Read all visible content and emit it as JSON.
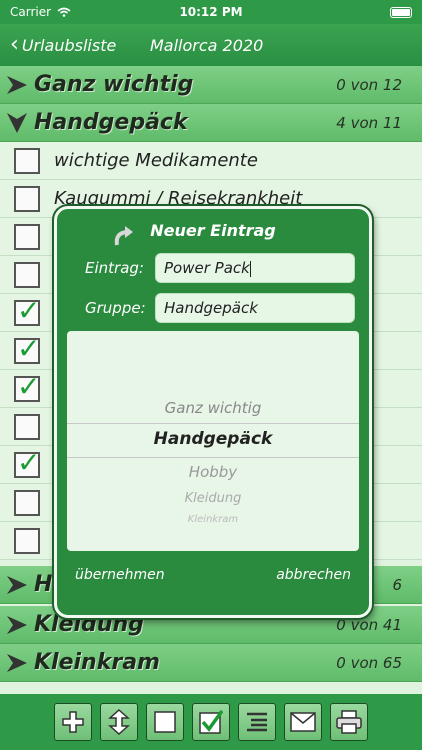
{
  "status": {
    "carrier": "Carrier",
    "time": "10:12 PM"
  },
  "nav": {
    "back_label": "Urlaubsliste",
    "title": "Mallorca 2020"
  },
  "groups": {
    "g1": {
      "name": "Ganz wichtig",
      "count": "0 von 12"
    },
    "g2": {
      "name": "Handgepäck",
      "count": "4 von 11"
    },
    "g3": {
      "name": "H",
      "count": "6"
    },
    "g4": {
      "name": "Kleidung",
      "count": "0 von 41"
    },
    "g5": {
      "name": "Kleinkram",
      "count": "0 von 65"
    }
  },
  "items": [
    {
      "name": "wichtige Medikamente",
      "checked": false
    },
    {
      "name": "Kaugummi / Reisekrankheit",
      "checked": false
    },
    {
      "name": "",
      "checked": false
    },
    {
      "name": "",
      "checked": false
    },
    {
      "name": "",
      "checked": true
    },
    {
      "name": "",
      "checked": true
    },
    {
      "name": "",
      "checked": true
    },
    {
      "name": "",
      "checked": false
    },
    {
      "name": "",
      "checked": true
    },
    {
      "name": "",
      "checked": false
    },
    {
      "name": "",
      "checked": false
    }
  ],
  "dialog": {
    "title": "Neuer Eintrag",
    "entry_label": "Eintrag:",
    "entry_value": "Power Pack",
    "group_label": "Gruppe:",
    "group_value": "Handgepäck",
    "picker": [
      "Ganz wichtig",
      "Handgepäck",
      "Hobby",
      "Kleidung",
      "Kleinkram"
    ],
    "picker_selected": "Handgepäck",
    "accept": "übernehmen",
    "cancel": "abbrechen"
  },
  "toolbar": [
    "plus-icon",
    "move-vertical-icon",
    "checkbox-empty-icon",
    "checkbox-checked-icon",
    "list-icon",
    "mail-icon",
    "print-icon"
  ],
  "colors": {
    "primary": "#2e9a48",
    "group": "#6cc276",
    "item": "#e4f6e3",
    "check": "#1a9a32"
  }
}
